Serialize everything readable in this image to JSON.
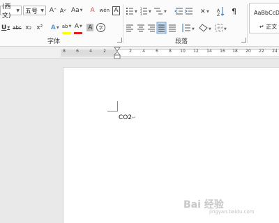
{
  "font": {
    "name_value": "(西文)",
    "size_value": "五号",
    "grow_label": "A",
    "shrink_label": "A",
    "case_label": "Aa",
    "clear_format_label": "A",
    "pinyin_label": "wén",
    "border_char_label": "A",
    "underline_label": "U",
    "strike_label": "abc",
    "subscript_label": "x₂",
    "superscript_label": "x²",
    "effect_label": "A",
    "highlight_label": "ab",
    "color_label": "A",
    "shading_label": "A",
    "enclose_label": "字",
    "group_label": "字体"
  },
  "paragraph": {
    "group_label": "段落"
  },
  "styles": {
    "sample": "AaBbCcDd",
    "style_name": "↵ 正文"
  },
  "ruler": {
    "ticks": [
      "8",
      "6",
      "4",
      "2",
      "2",
      "4",
      "6",
      "8",
      "10",
      "12",
      "14",
      "16",
      "18",
      "20",
      "22",
      "24"
    ]
  },
  "document": {
    "text": "CO2"
  },
  "watermark": {
    "main": "Bai 经验",
    "sub": "jingyan.baidu.com"
  }
}
